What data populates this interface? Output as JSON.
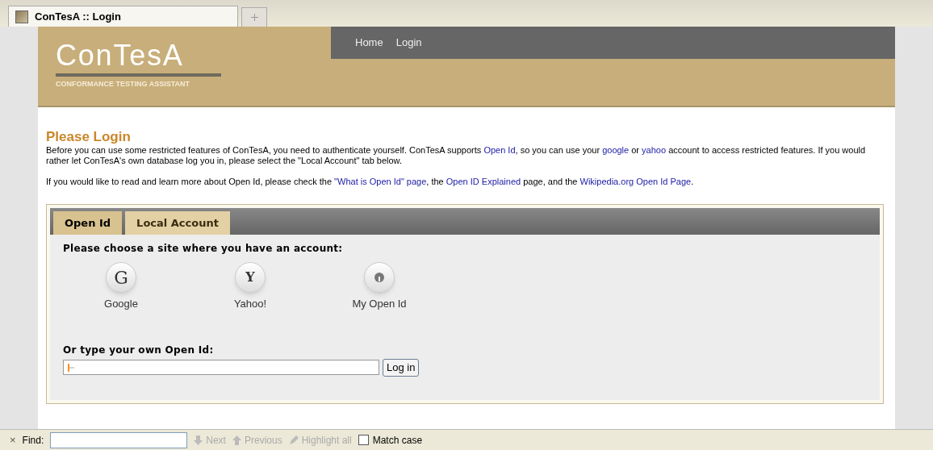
{
  "browser_tab": {
    "title": "ConTesA :: Login",
    "selected": true
  },
  "header": {
    "logo": "ConTesA",
    "tagline": "CONFORMANCE TESTING ASSISTANT",
    "nav": [
      "Home",
      "Login"
    ]
  },
  "heading": "Please Login",
  "paragraphs": [
    [
      {
        "text": "Before you can use some restricted features of ConTesA, you need to authenticate yourself. ConTesA supports ",
        "kind": "text"
      },
      {
        "text": "Open Id",
        "kind": "link"
      },
      {
        "text": ", so you can use your ",
        "kind": "text"
      },
      {
        "text": "google",
        "kind": "link"
      },
      {
        "text": " or ",
        "kind": "text"
      },
      {
        "text": "yahoo",
        "kind": "link"
      },
      {
        "text": " account to access restricted features. If you would rather let ConTesA's own database log you in, please select the \"Local Account\" tab below.",
        "kind": "text"
      }
    ],
    [
      {
        "text": "If you would like to read and learn more about Open Id, please check the ",
        "kind": "text"
      },
      {
        "text": "\"What is Open Id\" page",
        "kind": "link"
      },
      {
        "text": ", the ",
        "kind": "text"
      },
      {
        "text": "Open ID Explained",
        "kind": "link"
      },
      {
        "text": " page, and the ",
        "kind": "text"
      },
      {
        "text": "Wikipedia.org Open Id Page",
        "kind": "link"
      },
      {
        "text": ".",
        "kind": "text"
      }
    ]
  ],
  "tabs": [
    {
      "label": "Open Id",
      "selected": true
    },
    {
      "label": "Local Account",
      "selected": false
    }
  ],
  "choose_label": "Please choose a site where you have an account:",
  "providers": [
    {
      "kind": "google",
      "glyph": "G",
      "label": "Google"
    },
    {
      "kind": "yahoo",
      "glyph": "Y",
      "label": "Yahoo!"
    },
    {
      "kind": "openid",
      "label": "My Open Id"
    }
  ],
  "own_label": "Or type your own Open Id:",
  "login_button": "Log in",
  "find_bar": {
    "close": "×",
    "label": "Find:",
    "next": "Next",
    "previous": "Previous",
    "highlight": "Highlight all",
    "match_case": {
      "label": "Match case",
      "checked": false
    }
  }
}
